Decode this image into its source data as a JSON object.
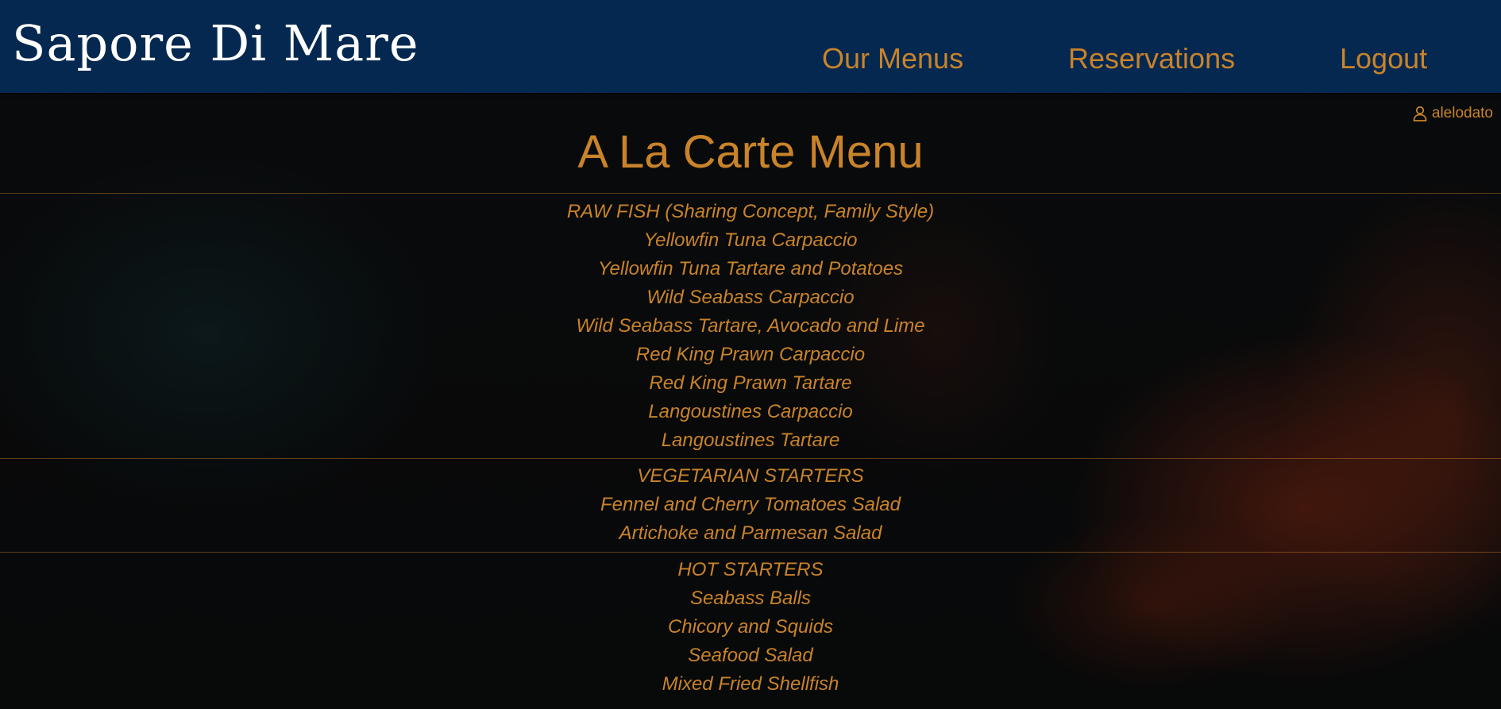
{
  "brand": "Sapore Di Mare",
  "nav": {
    "menus": "Our Menus",
    "reservations": "Reservations",
    "logout": "Logout"
  },
  "user": {
    "icon": "user-icon",
    "name": "alelodato"
  },
  "page_title": "A La Carte Menu",
  "colors": {
    "header_bg": "#042850",
    "accent": "#c9832a",
    "brand_text": "#ffffff"
  },
  "sections": [
    {
      "heading": "RAW FISH (Sharing Concept, Family Style)",
      "items": [
        "Yellowfin Tuna Carpaccio",
        "Yellowfin Tuna Tartare and Potatoes",
        "Wild Seabass Carpaccio",
        "Wild Seabass Tartare, Avocado and Lime",
        "Red King Prawn Carpaccio",
        "Red King Prawn Tartare",
        "Langoustines Carpaccio",
        "Langoustines Tartare"
      ]
    },
    {
      "heading": "VEGETARIAN STARTERS",
      "items": [
        "Fennel and Cherry Tomatoes Salad",
        "Artichoke and Parmesan Salad"
      ]
    },
    {
      "heading": "HOT STARTERS",
      "items": [
        "Seabass Balls",
        "Chicory and Squids",
        "Seafood Salad",
        "Mixed Fried Shellfish"
      ]
    }
  ]
}
